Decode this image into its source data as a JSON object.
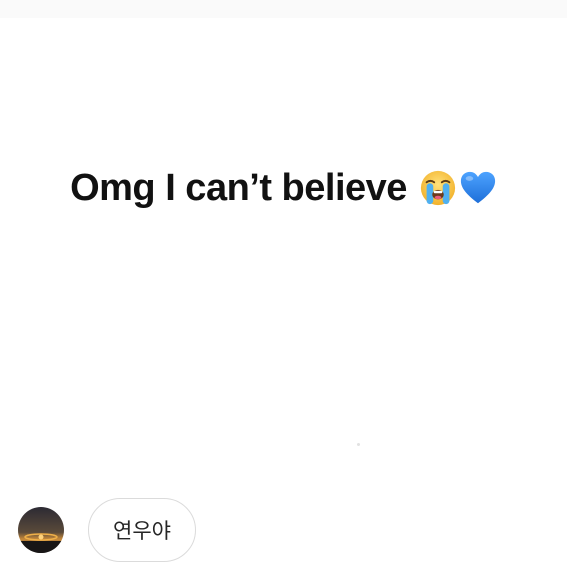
{
  "headline": {
    "text": "Omg I can’t believe",
    "emojis": [
      "loudly-crying-face-icon",
      "blue-heart-icon"
    ]
  },
  "message": {
    "avatar": "avatar-sunset-photo",
    "text": "연우야"
  },
  "colors": {
    "background": "#ffffff",
    "text": "#111111",
    "bubble_border": "#dbdbdb",
    "heart": "#2f86f2",
    "emoji_face": "#f7c842"
  }
}
